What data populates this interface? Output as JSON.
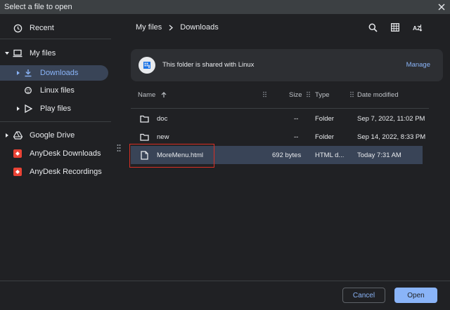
{
  "window": {
    "title": "Select a file to open"
  },
  "sidebar": {
    "items": [
      {
        "label": "Recent",
        "icon": "clock-icon"
      },
      {
        "label": "My files",
        "icon": "laptop-icon"
      },
      {
        "label": "Downloads",
        "icon": "download-icon"
      },
      {
        "label": "Linux files",
        "icon": "linux-icon"
      },
      {
        "label": "Play files",
        "icon": "play-icon"
      },
      {
        "label": "Google Drive",
        "icon": "drive-icon"
      },
      {
        "label": "AnyDesk Downloads",
        "icon": "anydesk-icon"
      },
      {
        "label": "AnyDesk Recordings",
        "icon": "anydesk-icon"
      }
    ]
  },
  "breadcrumb": {
    "root": "My files",
    "current": "Downloads"
  },
  "toolbar": {
    "sort_label": "AZ"
  },
  "banner": {
    "text": "This folder is shared with Linux",
    "action": "Manage"
  },
  "list": {
    "columns": {
      "name": "Name",
      "size": "Size",
      "type": "Type",
      "modified": "Date modified"
    },
    "rows": [
      {
        "name": "doc",
        "size": "--",
        "type": "Folder",
        "modified": "Sep 7, 2022, 11:02 PM"
      },
      {
        "name": "new",
        "size": "--",
        "type": "Folder",
        "modified": "Sep 14, 2022, 8:33 PM"
      },
      {
        "name": "MoreMenu.html",
        "size": "692 bytes",
        "type": "HTML d...",
        "modified": "Today 7:31 AM"
      }
    ]
  },
  "footer": {
    "cancel_label": "Cancel",
    "open_label": "Open"
  },
  "colors": {
    "accent": "#8ab4f8",
    "background": "#202124",
    "selected": "#394457",
    "highlight": "#d93025"
  }
}
